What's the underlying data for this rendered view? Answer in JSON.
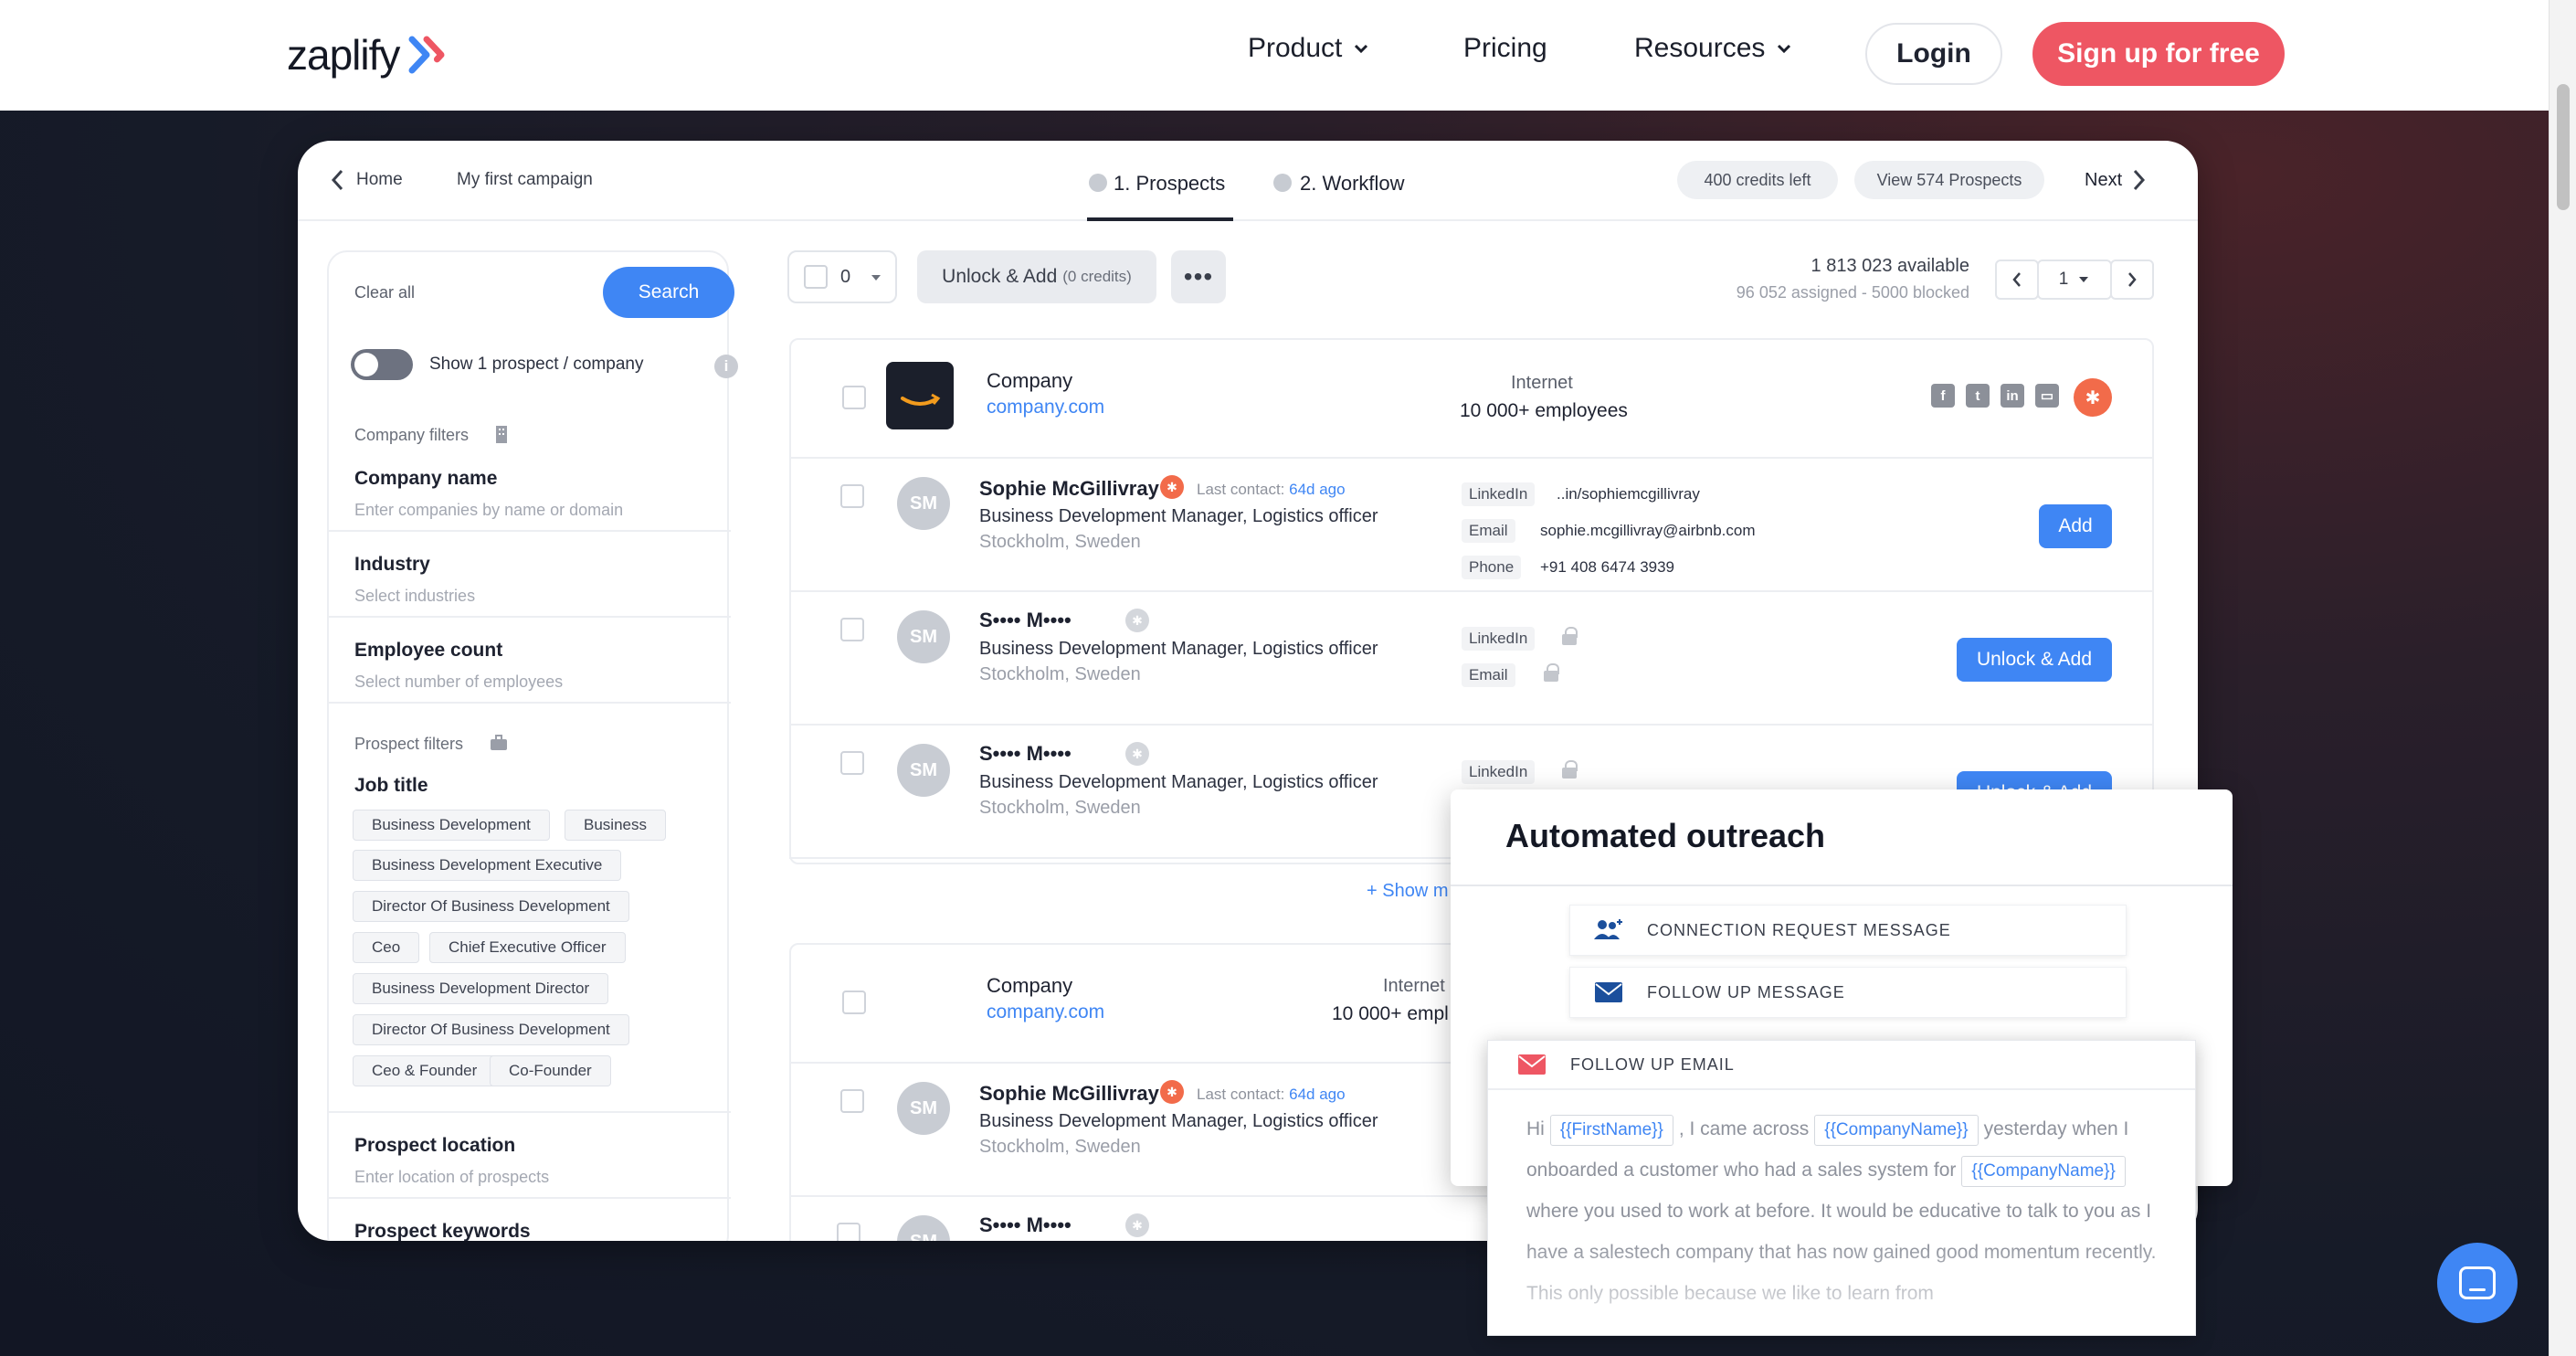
{
  "nav": {
    "logo_text": "zaplify",
    "items": [
      {
        "label": "Product"
      },
      {
        "label": "Pricing"
      },
      {
        "label": "Resources"
      }
    ],
    "login_label": "Login",
    "signup_label": "Sign up for free",
    "accent_color": "#ee5663"
  },
  "app": {
    "breadcrumb": {
      "home": "Home",
      "campaign": "My first campaign"
    },
    "tabs": [
      {
        "label": "1. Prospects",
        "active": true
      },
      {
        "label": "2. Workflow",
        "active": false
      }
    ],
    "credits_label": "400 credits left",
    "view_prospects_label": "View 574 Prospects",
    "next_label": "Next"
  },
  "sidebar": {
    "clear_all": "Clear all",
    "search_label": "Search",
    "toggle_label": "Show 1 prospect / company",
    "company_filters": "Company filters",
    "company_name": {
      "label": "Company name",
      "placeholder": "Enter companies by name or domain"
    },
    "industry": {
      "label": "Industry",
      "placeholder": "Select industries"
    },
    "employee_count": {
      "label": "Employee count",
      "placeholder": "Select number of employees"
    },
    "prospect_filters": "Prospect filters",
    "job_title_label": "Job title",
    "job_titles": [
      "Business Development",
      "Business",
      "Business Development Executive",
      "Director Of Business Development",
      "Ceo",
      "Chief Executive Officer",
      "Business Development Director",
      "Director Of Business Development",
      "Ceo & Founder",
      "Co-Founder"
    ],
    "prospect_location": {
      "label": "Prospect location",
      "placeholder": "Enter location of prospects"
    },
    "prospect_keywords": {
      "label": "Prospect keywords"
    }
  },
  "toolbar": {
    "selected_count": "0",
    "unlock_add_label": "Unlock & Add",
    "unlock_add_credits": "(0 credits)",
    "more_label": "•••",
    "available": "1 813 023 available",
    "assigned_blocked": "96 052 assigned - 5000 blocked",
    "page": "1"
  },
  "companies": [
    {
      "name": "Company",
      "domain": "company.com",
      "industry": "Internet",
      "employees": "10 000+ employees",
      "prospects": [
        {
          "initials": "SM",
          "name": "Sophie McGillivray",
          "last_contact_label": "Last contact:",
          "last_contact": "64d ago",
          "role": "Business Development Manager, Logistics officer",
          "location": "Stockholm, Sweden",
          "linkedin": "..in/sophiemcgillivray",
          "email": "sophie.mcgillivray@airbnb.com",
          "phone": "+91 408 6474 3939",
          "action": "Add"
        },
        {
          "initials": "SM",
          "name": "S•••• M••••",
          "role": "Business Development Manager, Logistics officer",
          "location": "Stockholm, Sweden",
          "action": "Unlock & Add"
        },
        {
          "initials": "SM",
          "name": "S•••• M••••",
          "role": "Business Development Manager, Logistics officer",
          "location": "Stockholm, Sweden",
          "action": "Unlock & Add"
        }
      ],
      "show_more": "+ Show m"
    },
    {
      "name": "Company",
      "domain": "company.com",
      "industry": "Internet",
      "employees": "10 000+ empl",
      "prospects": [
        {
          "initials": "SM",
          "name": "Sophie McGillivray",
          "last_contact_label": "Last contact:",
          "last_contact": "64d ago",
          "role": "Business Development Manager, Logistics officer",
          "location": "Stockholm, Sweden"
        },
        {
          "initials": "SM",
          "name": "S•••• M••••"
        }
      ]
    }
  ],
  "field_labels": {
    "linkedin": "LinkedIn",
    "email": "Email",
    "phone": "Phone"
  },
  "outreach": {
    "title": "Automated outreach",
    "steps": [
      "CONNECTION REQUEST MESSAGE",
      "FOLLOW UP MESSAGE",
      "FOLLOW UP EMAIL"
    ],
    "email_body": {
      "hi": "Hi",
      "first_name_tag": "{{FirstName}}",
      "came_across": ", I came across",
      "company_tag": "{{CompanyName}}",
      "yesterday": "yesterday when I onboarded a customer who had a sales system for",
      "rest": "where you used to work at before. It would be educative to talk to you as I have a salestech company that has now gained good momentum recently. This only possible because we like to learn from"
    }
  },
  "icons": [
    "chevron-down-icon",
    "chevron-left-icon",
    "chevron-right-icon",
    "check-circle-icon",
    "info-icon",
    "building-icon",
    "briefcase-icon",
    "lock-icon",
    "hubspot-icon",
    "facebook-icon",
    "twitter-icon",
    "linkedin-icon",
    "card-icon",
    "users-icon",
    "envelope-icon",
    "chat-icon"
  ]
}
